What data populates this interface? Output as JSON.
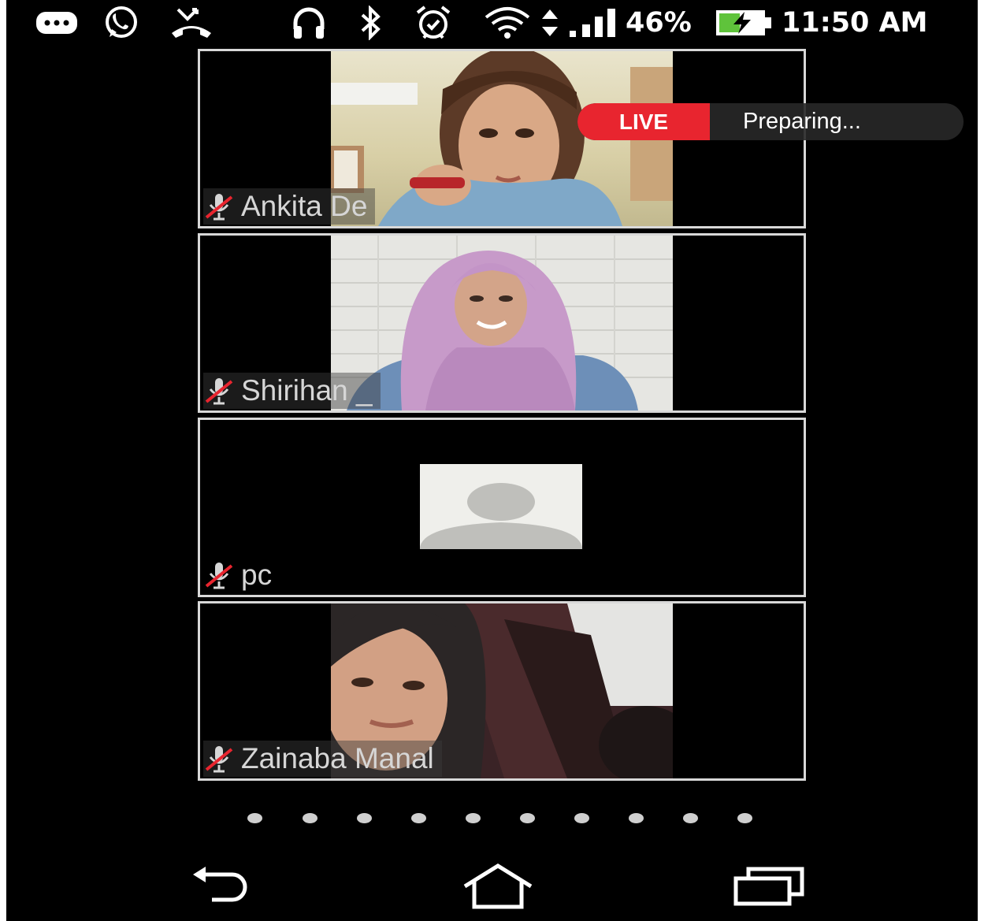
{
  "status_bar": {
    "icons": [
      "chat-bubble-icon",
      "whatsapp-icon",
      "missed-call-icon",
      "headset-icon",
      "bluetooth-icon",
      "alarm-icon",
      "wifi-icon",
      "data-arrows-icon",
      "signal-icon",
      "battery-charging-icon"
    ],
    "battery_percent": "46%",
    "time": "11:50 AM"
  },
  "live": {
    "badge": "LIVE",
    "status": "Preparing..."
  },
  "participants": [
    {
      "name": "Ankita De",
      "muted": true,
      "video": "on"
    },
    {
      "name": "Shirihan _",
      "muted": true,
      "video": "on"
    },
    {
      "name": "pc",
      "muted": true,
      "video": "off"
    },
    {
      "name": "Zainaba Manal",
      "muted": true,
      "video": "on"
    }
  ],
  "pagination": {
    "page_count": 10
  },
  "nav": {
    "icons": [
      "back-icon",
      "home-icon",
      "recents-icon"
    ]
  },
  "colors": {
    "live_red": "#e8252f",
    "battery_green": "#5fc33b",
    "background": "#000000"
  }
}
